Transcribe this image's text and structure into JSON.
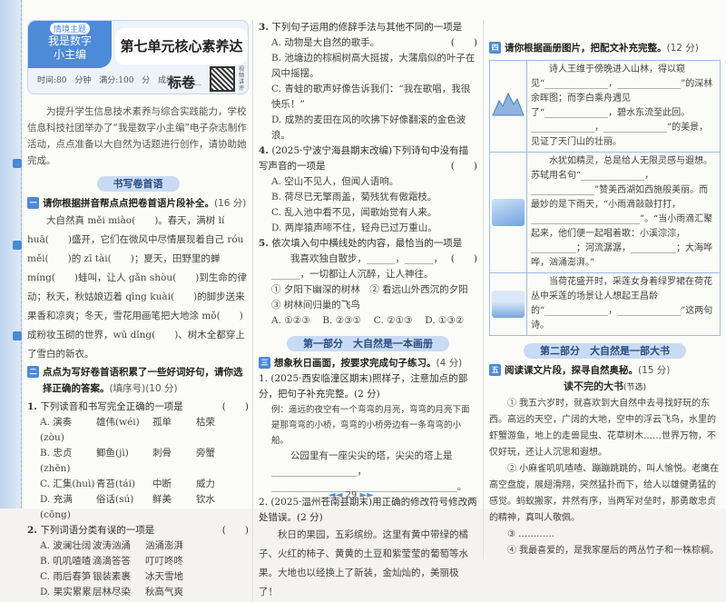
{
  "header": {
    "theme_tag": "情境主题",
    "theme_line1": "我是数字",
    "theme_line2": "小主编",
    "title": "第七单元核心素养达标卷",
    "meta": "时间:80 分钟  满分:100 分  成绩:______",
    "qr_caption": "视频讲评"
  },
  "intro": "为提升学生信息技术素养与综合实践能力，学校信息科技社团举办了“我是数字小主编”电子杂志制作活动，点点准备以大自然为话题进行创作，请协助她完成。",
  "banner1": "书写卷首语",
  "s1": {
    "n": "一",
    "title": "请你根据拼音帮点点把卷首语片段补全。",
    "pts": "(16 分)",
    "text": "大自然真 měi miào(　　)。春天，满树 lí huā(　　)盛开，它们在微风中尽情展现着自己 róu měi(　　)的 zī tài(　　)；夏天，田野里的蝉 míng(　　)蛙叫，让人 gǎn shòu(　　)到生命的律动；秋天，秋姑娘迈着 qīng kuài(　　)的脚步送来果香和凉爽；冬天，雪花用画笔把大地涂 mǒ(　　)成粉妆玉砌的世界，wū dǐng(　　)、树木全都穿上了雪白的新衣。"
  },
  "s2": {
    "n": "二",
    "title": "点点为写好卷首语积累了一些好词好句，请你选择正确的答案。",
    "pts": "(填序号)(10 分)"
  },
  "q1": {
    "num": "1.",
    "stem": "下列读音和书写完全正确的一项是",
    "paren": "(　　)",
    "rows": [
      [
        "A. 演奏(zòu)",
        "雄伟(wéi)",
        "孤单",
        "枯荣"
      ],
      [
        "B. 忠贞(zhēn)",
        "鲫鱼(jì)",
        "刺骨",
        "旁蟹"
      ],
      [
        "C. 汇集(huì)",
        "青苔(tái)",
        "中断",
        "威力"
      ],
      [
        "D. 充满(cōng)",
        "俗话(sú)",
        "鲜美",
        "钦水"
      ]
    ]
  },
  "q2": {
    "num": "2.",
    "stem": "下列词语分类有误的一项是",
    "paren": "(　　)",
    "rows": [
      [
        "A. 波澜壮阔",
        "波涛汹涌",
        "汹涌澎湃"
      ],
      [
        "B. 叽叽喳喳",
        "滴滴答答",
        "叮叮咚咚"
      ],
      [
        "C. 雨后春笋",
        "银装素裹",
        "冰天雪地"
      ],
      [
        "D. 果实累累",
        "层林尽染",
        "秋高气爽"
      ]
    ]
  },
  "q3": {
    "num": "3.",
    "stem": "下列句子运用的修辞手法与其他不同的一项是",
    "paren": "(　　)",
    "opts": [
      "A. 动物是大自然的歌手。",
      "B. 池塘边的棕榈树高大挺拔，大蒲扇似的叶子在风中摇摆。",
      "C. 青蛙的歌声好像告诉我们：“我在歌唱，我很快乐！”",
      "D. 成熟的麦田在风的吹拂下好像翻滚的金色波浪。"
    ]
  },
  "q4": {
    "num": "4.",
    "stem": "(2025·宁波宁海县期末改编)下列诗句中没有描写声音的一项是",
    "paren": "(　　)",
    "opts": [
      "A. 空山不见人，但闻人语响。",
      "B. 荷尽已无擎雨盖，菊残犹有傲霜枝。",
      "C. 乱入池中看不见，闻歌始觉有人来。",
      "D. 两岸猿声啼不住，轻舟已过万重山。"
    ]
  },
  "q5": {
    "num": "5.",
    "stem": "依次填入句中横线处的内容，最恰当的一项是",
    "paren": "(　　)",
    "sentence": "我喜欢独自散步，______，______，______，一切都让人沉醉，让人神往。",
    "items": "① 夕阳下幽深的树林　② 看远山外西沉的夕阳",
    "item3": "③ 树林间归巢的飞鸟",
    "choices": "A. ①②③　 B. ②③①　 C. ②①③　 D. ①③②"
  },
  "banner2": "第一部分　大自然是一本画册",
  "s3": {
    "n": "三",
    "title": "想象秋日画面，按要求完成句子练习。",
    "pts": "(4 分)",
    "q1": "1. (2025·西安临潼区期末)照样子，注意加点的部分，把句子补充完整。(2 分)",
    "example": "例：遥远的夜空有一个弯弯的月亮，弯弯的月亮下面是那弯弯的小桥，弯弯的小桥旁边有一条弯弯的小船。",
    "fill": "公园里有一座尖尖的塔，尖尖的塔上是__________________，_______________________________________。",
    "q2": "2. (2025·温州苍南县期末)用正确的修改符号修改两处错误。(2 分)",
    "passage": "秋日的果园，五彩缤纷。这里有黄中带绿的橘子、火红的柿子、黄黄的土豆和紫莹莹的葡萄等水果。大地也以经换上了新装，金灿灿的，美丽极了！"
  },
  "s4": {
    "n": "四",
    "title": "请你根据画册图片，把配文补充完整。",
    "pts": "(12 分)",
    "rows": [
      "诗人王维于傍晚进入山林，得以窥见“______________，______________”的深林余晖图；而李白乘舟遇见了“______________，碧水东流至此回。______________，______________”的美景，见证了天门山的壮丽。",
      "水犹如精灵，总是给人无限灵感与遐想。苏轼用名句“______________，______________”赞美西湖如西施般美丽。而最妙的是下雨天，“小雨滴敲敲打打，________________________”。“当小雨滴汇聚起来，他们便一起唱着歌：小溪淙淙，__________；河流潺潺，__________；大海哗哗，汹涌澎湃。”",
      "当荷花盛开时，采莲女身着绿罗裙在荷花丛中采莲的场景让人想起王昌龄的“______________，______________”这两句诗。"
    ]
  },
  "banner3": "第二部分　大自然是一部大书",
  "s5": {
    "n": "五",
    "title": "阅读课文片段，探寻自然奥秘。",
    "pts": "(15 分)",
    "article_title": "读不完的大书",
    "article_note": "(节选)",
    "paras": [
      "① 我五六岁时，就喜欢到大自然中去寻找好玩的东西。高远的天空，广阔的大地，空中的浮云飞鸟，水里的虾蟹游鱼，地上的走兽昆虫、花草树木……世界万物，不仅好玩，还让人沉思和遐想。",
      "② 小麻雀叽叽喳喳、蹦蹦跳跳的，叫人愉悦。老鹰在高空盘旋，展翅滑翔，突然猛扑而下，给人以雄健勇猛的感觉。蚂蚁搬家，井然有序，当两军对垒时，那勇敢忠贞的精神，真叫人敬佩。",
      "③ …………",
      "④ 我最喜爱的，是我家屋后的两丛竹子和一株棕榈。"
    ]
  },
  "footer": {
    "page": "29",
    "prev": "◄◄",
    "next": "►►"
  },
  "colors": {
    "accent": "#4d8ad8",
    "banner": "#c9dbf3"
  }
}
